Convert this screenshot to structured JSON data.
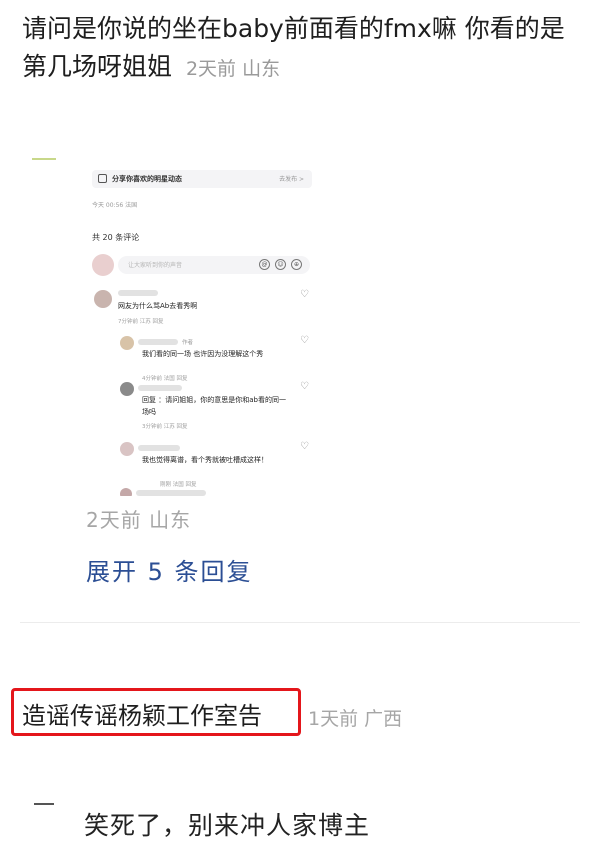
{
  "comment": {
    "text": "请问是你说的坐在baby前面看的fmx嘛 你看的是第几场呀姐姐",
    "meta": "2天前 山东"
  },
  "embedded_screenshot": {
    "share_prompt": "分享你喜欢的明星动态",
    "share_action": "去发布 >",
    "post_time": "今天 00:56 法国",
    "comment_count": "共 20 条评论",
    "input_placeholder": "让大家听到你的声音",
    "input_icons": [
      "@",
      "☺",
      "⊕"
    ],
    "comments": [
      {
        "text": "网友为什么骂Ab去看秀啊",
        "sub": "7分钟前 江苏 回复"
      },
      {
        "tag": "作者",
        "text": "我们看的同一场 也许因为没理解这个秀",
        "sub": "4分钟前 法国 回复"
      },
      {
        "text": "回复 ：请问姐姐，你的意思是你和ab看的同一场吗",
        "sub": "3分钟前 江苏 回复"
      },
      {
        "text": "我也觉得离谱，看个秀就被吐槽成这样！",
        "sub": "刚刚 法国 回复"
      }
    ]
  },
  "reply_meta": "2天前 山东",
  "expand_label": "展开 5 条回复",
  "second_comment": {
    "username": "造谣传谣杨颖工作室告",
    "meta": "1天前 广西",
    "text": "笑死了，别来冲人家博主"
  },
  "colors": {
    "highlight_border": "#e4161b",
    "link_blue": "#2b4e94"
  }
}
